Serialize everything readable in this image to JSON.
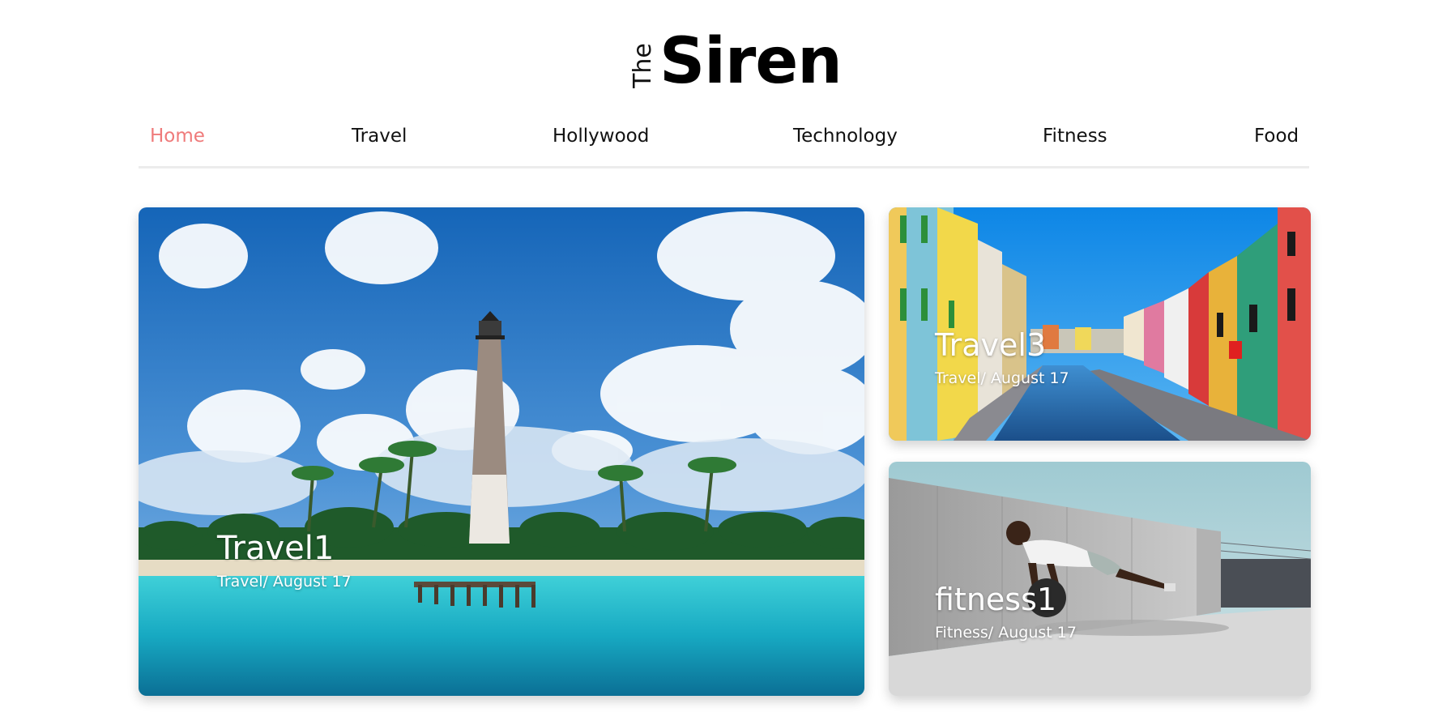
{
  "logo": {
    "prefix": "The",
    "name": "Siren"
  },
  "nav": {
    "items": [
      {
        "label": "Home",
        "active": true
      },
      {
        "label": "Travel",
        "active": false
      },
      {
        "label": "Hollywood",
        "active": false
      },
      {
        "label": "Technology",
        "active": false
      },
      {
        "label": "Fitness",
        "active": false
      },
      {
        "label": "Food",
        "active": false
      }
    ],
    "active_color": "#ef7a7a"
  },
  "cards": {
    "main": {
      "title": "Travel1",
      "meta": "Travel/ August 17",
      "image": "lighthouse-beach"
    },
    "travel3": {
      "title": "Travel3",
      "meta": "Travel/ August 17",
      "image": "colorful-canal"
    },
    "fitness": {
      "title": "fitness1",
      "meta": "Fitness/ August 17",
      "image": "pushup-medicine-ball"
    }
  }
}
